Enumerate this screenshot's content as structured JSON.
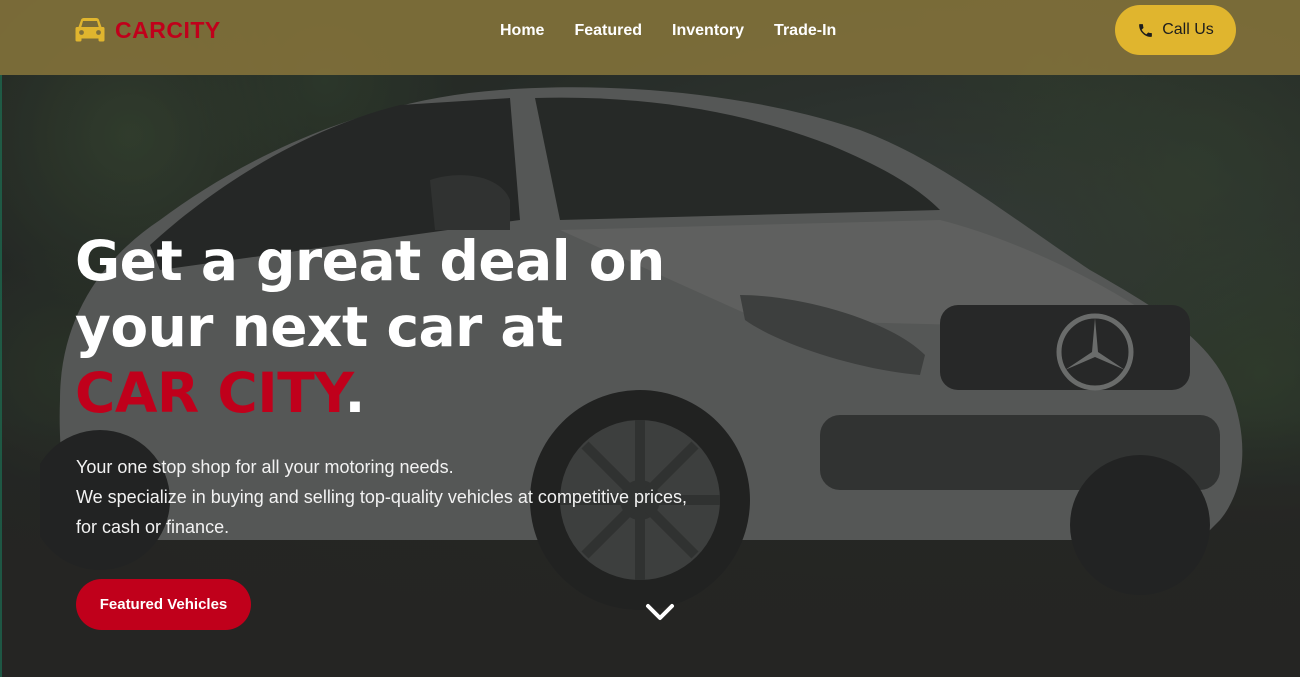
{
  "brand": {
    "name": "CARCITY",
    "icon": "car-icon"
  },
  "nav": {
    "items": [
      {
        "label": "Home"
      },
      {
        "label": "Featured"
      },
      {
        "label": "Inventory"
      },
      {
        "label": "Trade-In"
      }
    ]
  },
  "call_button": {
    "label": "Call Us",
    "icon": "phone-icon"
  },
  "hero": {
    "headline_part1": "Get a great deal on your next car at ",
    "headline_accent": "CAR CITY",
    "headline_end": ".",
    "description_line1": "Your one stop shop for all your motoring needs.",
    "description_line2": "We specialize in buying and selling top-quality vehicles at competitive prices, for cash or finance.",
    "cta_label": "Featured Vehicles",
    "scroll_icon": "chevron-down-icon"
  },
  "colors": {
    "navbar": "#80703a",
    "brand_red": "#c0001b",
    "accent_yellow": "#e0b52e"
  }
}
